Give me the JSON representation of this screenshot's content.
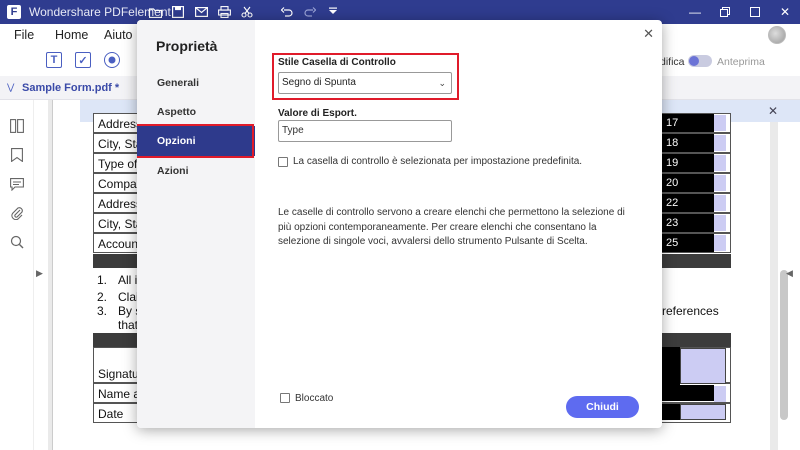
{
  "app": {
    "title": "Wondershare PDFelement",
    "logo_letter": "F",
    "colors": {
      "titlebar": "#2f3c8f",
      "accent": "#5e6bf0",
      "active_nav": "#2e3a8c",
      "highlight": "#e01b2a"
    }
  },
  "quick_access": [
    "folder-icon",
    "save-icon",
    "mail-icon",
    "print-icon",
    "scissors-icon",
    "undo-icon",
    "redo-icon",
    "dropdown-icon"
  ],
  "window_controls": [
    "minimize-icon",
    "restore-icon",
    "maximize-icon",
    "close-icon"
  ],
  "menu": {
    "file": "File",
    "home": "Home",
    "help": "Aiuto"
  },
  "toolbar": {
    "tools": [
      "text-field-icon",
      "checkbox-tool-icon",
      "radio-tool-icon"
    ],
    "edit_label": "difica",
    "preview_label": "Anteprima"
  },
  "tab": {
    "label": "Sample Form.pdf *"
  },
  "document": {
    "rows": [
      {
        "label": "Address",
        "num": "17"
      },
      {
        "label": "City, Sta",
        "num": "18"
      },
      {
        "label": "Type of a",
        "num": "19"
      },
      {
        "label": "Compan",
        "num": "20"
      },
      {
        "label": "Address",
        "num": "22"
      },
      {
        "label": "City, Sta",
        "num": "23"
      },
      {
        "label": "Account",
        "num": "25"
      }
    ],
    "list": [
      {
        "num": "1.",
        "text": "All ir"
      },
      {
        "num": "2.",
        "text": "Clai"
      },
      {
        "num": "3.",
        "text": "By s"
      },
      {
        "num": "",
        "text": "that"
      }
    ],
    "references": "references",
    "signature_rows": [
      "Signatur",
      "Name ar",
      "Date"
    ]
  },
  "dialog": {
    "title": "Proprietà",
    "nav": [
      {
        "label": "Generali"
      },
      {
        "label": "Aspetto"
      },
      {
        "label": "Opzioni"
      },
      {
        "label": "Azioni"
      }
    ],
    "active_nav": "Opzioni",
    "style_label": "Stile Casella di Controllo",
    "style_value": "Segno di Spunta",
    "export_label": "Valore di Esport.",
    "export_value": "Type",
    "default_checked_label": "La casella di controllo è selezionata per impostazione predefinita.",
    "description": "Le caselle di controllo servono a creare elenchi che permettono la selezione di più opzioni contemporaneamente. Per creare elenchi che consentano la selezione di singole voci, avvalersi dello strumento Pulsante di Scelta.",
    "locked_label": "Bloccato",
    "close_button": "Chiudi"
  }
}
